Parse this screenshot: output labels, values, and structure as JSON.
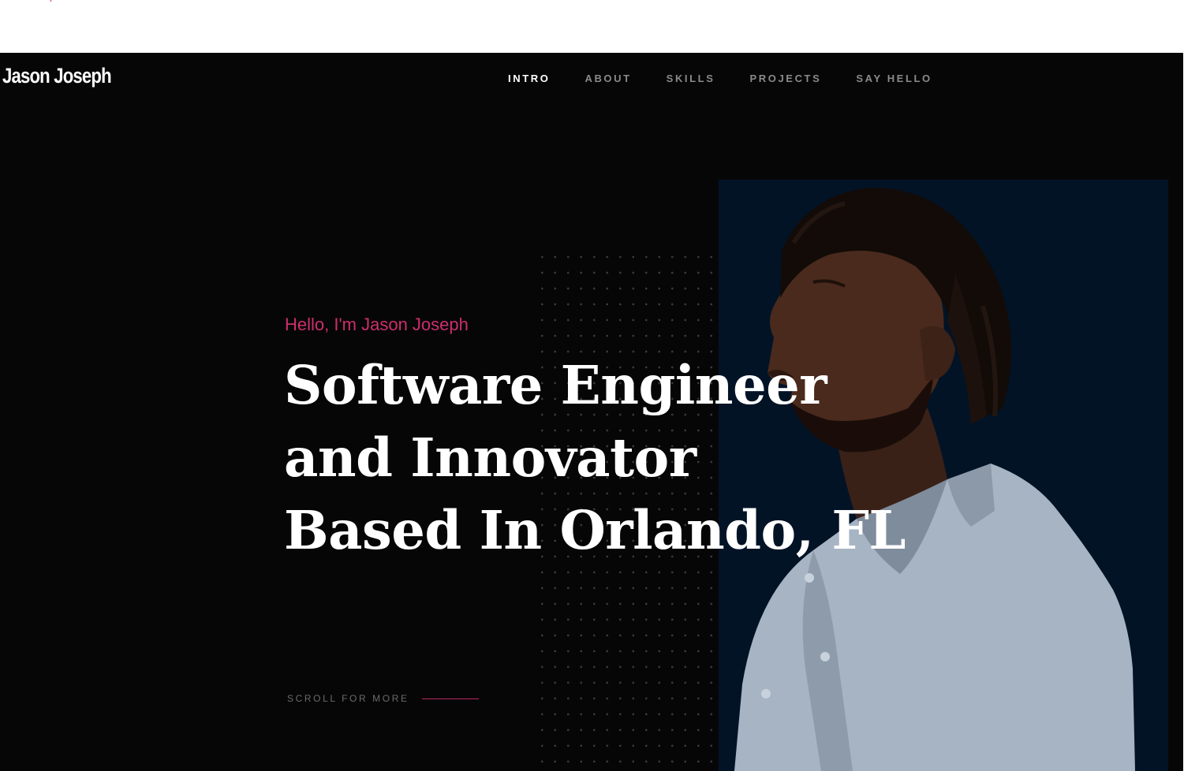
{
  "brand": {
    "name": "Jason Joseph"
  },
  "nav": {
    "items": [
      {
        "label": "INTRO",
        "active": true
      },
      {
        "label": "ABOUT",
        "active": false
      },
      {
        "label": "SKILLS",
        "active": false
      },
      {
        "label": "PROJECTS",
        "active": false
      },
      {
        "label": "SAY HELLO",
        "active": false
      }
    ]
  },
  "hero": {
    "greeting": "Hello, I'm Jason Joseph",
    "headline": [
      "Software Engineer",
      "and Innovator",
      "Based In Orlando, FL"
    ],
    "scroll_label": "SCROLL FOR MORE"
  },
  "colors": {
    "background": "#070607",
    "accent": "#cc2f6a",
    "photo_panel": "#021326",
    "nav_inactive": "#8a8a8a"
  }
}
